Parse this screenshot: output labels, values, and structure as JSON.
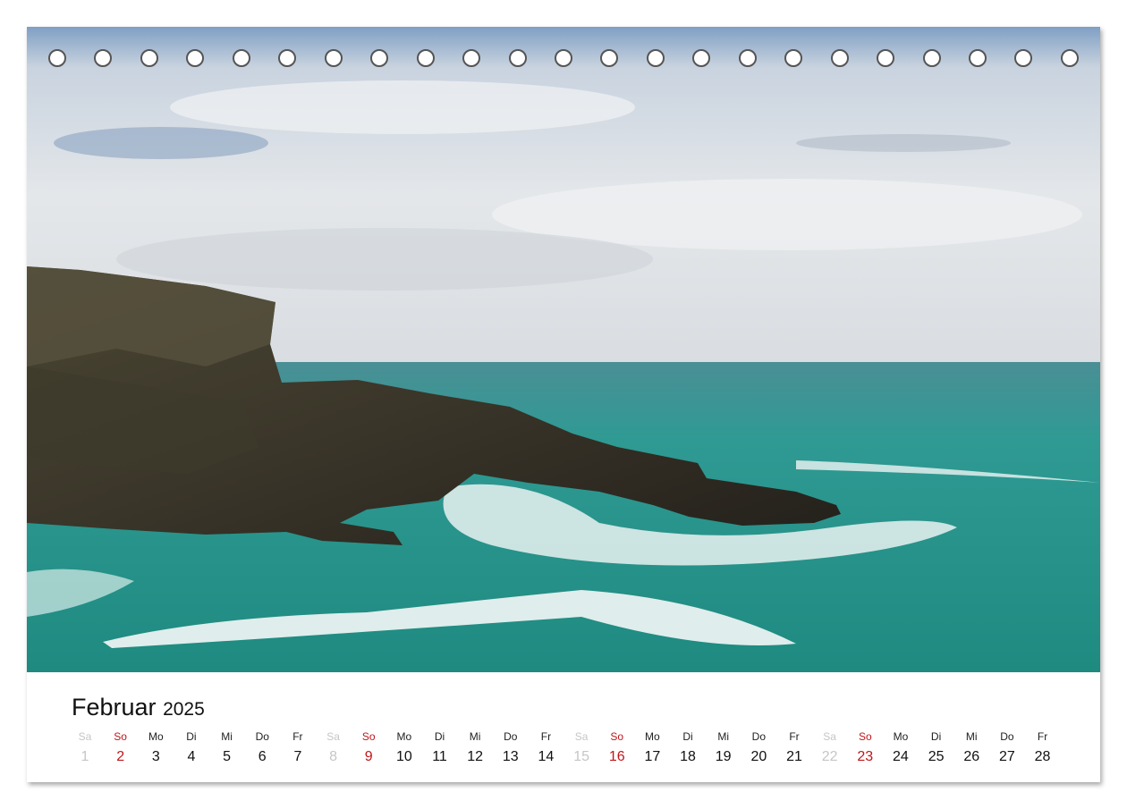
{
  "calendar": {
    "month": "Februar",
    "year": "2025",
    "days": [
      {
        "wd": "Sa",
        "n": "1",
        "type": "sat"
      },
      {
        "wd": "So",
        "n": "2",
        "type": "sun"
      },
      {
        "wd": "Mo",
        "n": "3",
        "type": "week"
      },
      {
        "wd": "Di",
        "n": "4",
        "type": "week"
      },
      {
        "wd": "Mi",
        "n": "5",
        "type": "week"
      },
      {
        "wd": "Do",
        "n": "6",
        "type": "week"
      },
      {
        "wd": "Fr",
        "n": "7",
        "type": "week"
      },
      {
        "wd": "Sa",
        "n": "8",
        "type": "sat"
      },
      {
        "wd": "So",
        "n": "9",
        "type": "sun"
      },
      {
        "wd": "Mo",
        "n": "10",
        "type": "week"
      },
      {
        "wd": "Di",
        "n": "11",
        "type": "week"
      },
      {
        "wd": "Mi",
        "n": "12",
        "type": "week"
      },
      {
        "wd": "Do",
        "n": "13",
        "type": "week"
      },
      {
        "wd": "Fr",
        "n": "14",
        "type": "week"
      },
      {
        "wd": "Sa",
        "n": "15",
        "type": "sat"
      },
      {
        "wd": "So",
        "n": "16",
        "type": "sun"
      },
      {
        "wd": "Mo",
        "n": "17",
        "type": "week"
      },
      {
        "wd": "Di",
        "n": "18",
        "type": "week"
      },
      {
        "wd": "Mi",
        "n": "19",
        "type": "week"
      },
      {
        "wd": "Do",
        "n": "20",
        "type": "week"
      },
      {
        "wd": "Fr",
        "n": "21",
        "type": "week"
      },
      {
        "wd": "Sa",
        "n": "22",
        "type": "sat"
      },
      {
        "wd": "So",
        "n": "23",
        "type": "sun"
      },
      {
        "wd": "Mo",
        "n": "24",
        "type": "week"
      },
      {
        "wd": "Di",
        "n": "25",
        "type": "week"
      },
      {
        "wd": "Mi",
        "n": "26",
        "type": "week"
      },
      {
        "wd": "Do",
        "n": "27",
        "type": "week"
      },
      {
        "wd": "Fr",
        "n": "28",
        "type": "week"
      }
    ]
  },
  "colors": {
    "sunday": "#c0161b",
    "saturday": "#c6c6c6",
    "sea": "#2f9a8f",
    "sky": "#dfe3e8"
  },
  "binding": {
    "hole_count": 23
  }
}
